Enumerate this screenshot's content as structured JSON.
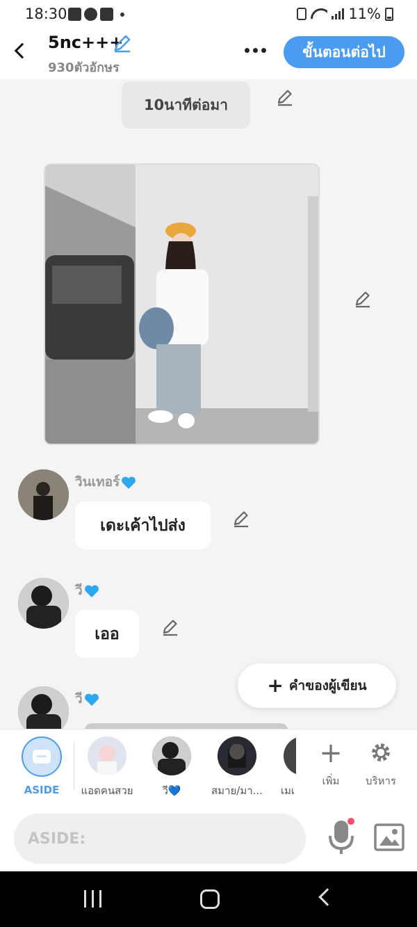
{
  "status_bar": {
    "time": "18:30",
    "battery": "11%"
  },
  "header": {
    "title": "5nc+++",
    "char_count": "930ตัวอักษร",
    "next_label": "ขั้นตอนต่อไป"
  },
  "chat": {
    "time_marker": "10นาทีต่อมา",
    "messages": [
      {
        "name": "วินเทอร์",
        "text": "เดะเค้าไปส่ง"
      },
      {
        "name": "วี",
        "text": "เออ"
      },
      {
        "name": "วี"
      }
    ],
    "author_button": "คำของผู้เขียน"
  },
  "characters": {
    "aside_label": "ASIDE",
    "items": [
      {
        "label": "แอดคนสวย"
      },
      {
        "label": "วี💙"
      },
      {
        "label": "สมาย/มา..."
      },
      {
        "label": "เมเ"
      }
    ],
    "add_label": "เพิ่ม",
    "manage_label": "บริหาร"
  },
  "input": {
    "placeholder": "ASIDE:"
  },
  "colors": {
    "accent": "#4a9cf0",
    "heart": "#2da8ee",
    "notify_dot": "#f0506e"
  }
}
